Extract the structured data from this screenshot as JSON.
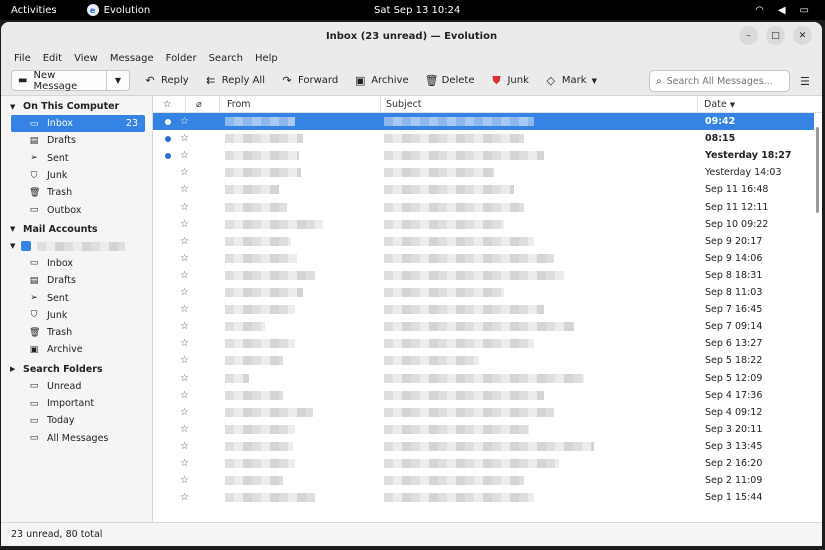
{
  "topbar": {
    "activities": "Activities",
    "app_name": "Evolution",
    "clock": "Sat Sep 13   10:24"
  },
  "window": {
    "title": "Inbox (23 unread) — Evolution"
  },
  "menu": [
    "File",
    "Edit",
    "View",
    "Message",
    "Folder",
    "Search",
    "Help"
  ],
  "toolbar": {
    "new_message": "New Message",
    "reply": "Reply",
    "reply_all": "Reply All",
    "forward": "Forward",
    "archive": "Archive",
    "delete": "Delete",
    "junk": "Junk",
    "mark": "Mark",
    "search_placeholder": "Search All Messages..."
  },
  "sidebar": {
    "on_this_computer": "On This Computer",
    "local_folders": [
      {
        "label": "Inbox",
        "count": "23",
        "icon": "inbox-icon"
      },
      {
        "label": "Drafts",
        "icon": "drafts-icon"
      },
      {
        "label": "Sent",
        "icon": "sent-icon"
      },
      {
        "label": "Junk",
        "icon": "junk-icon"
      },
      {
        "label": "Trash",
        "icon": "trash-icon"
      },
      {
        "label": "Outbox",
        "icon": "outbox-icon"
      }
    ],
    "mail_accounts": "Mail Accounts",
    "account_folders": [
      {
        "label": "Inbox"
      },
      {
        "label": "Drafts"
      },
      {
        "label": "Sent"
      },
      {
        "label": "Junk"
      },
      {
        "label": "Trash"
      },
      {
        "label": "Archive"
      }
    ],
    "search_folders": "Search Folders",
    "search_folder_items": [
      {
        "label": "Unread"
      },
      {
        "label": "Important"
      },
      {
        "label": "Today"
      },
      {
        "label": "All Messages"
      }
    ]
  },
  "list": {
    "columns": {
      "from": "From",
      "subject": "Subject",
      "date": "Date"
    },
    "rows": [
      {
        "date": "09:42",
        "unread": true,
        "selected": true
      },
      {
        "date": "08:15",
        "unread": true
      },
      {
        "date": "Yesterday 18:27",
        "unread": true
      },
      {
        "date": "Yesterday 14:03"
      },
      {
        "date": "Sep 11 16:48"
      },
      {
        "date": "Sep 11 12:11"
      },
      {
        "date": "Sep 10 09:22"
      },
      {
        "date": "Sep 9 20:17"
      },
      {
        "date": "Sep 9 14:06"
      },
      {
        "date": "Sep 8 18:31"
      },
      {
        "date": "Sep 8 11:03"
      },
      {
        "date": "Sep 7 16:45"
      },
      {
        "date": "Sep 7 09:14"
      },
      {
        "date": "Sep 6 13:27"
      },
      {
        "date": "Sep 5 18:22"
      },
      {
        "date": "Sep 5 12:09"
      },
      {
        "date": "Sep 4 17:36"
      },
      {
        "date": "Sep 4 09:12"
      },
      {
        "date": "Sep 3 20:11"
      },
      {
        "date": "Sep 3 13:45"
      },
      {
        "date": "Sep 2 16:20"
      },
      {
        "date": "Sep 2 11:09"
      },
      {
        "date": "Sep 1 15:44"
      }
    ]
  },
  "status": {
    "text": "23 unread, 80 total"
  },
  "colors": {
    "accent": "#3584e4"
  }
}
